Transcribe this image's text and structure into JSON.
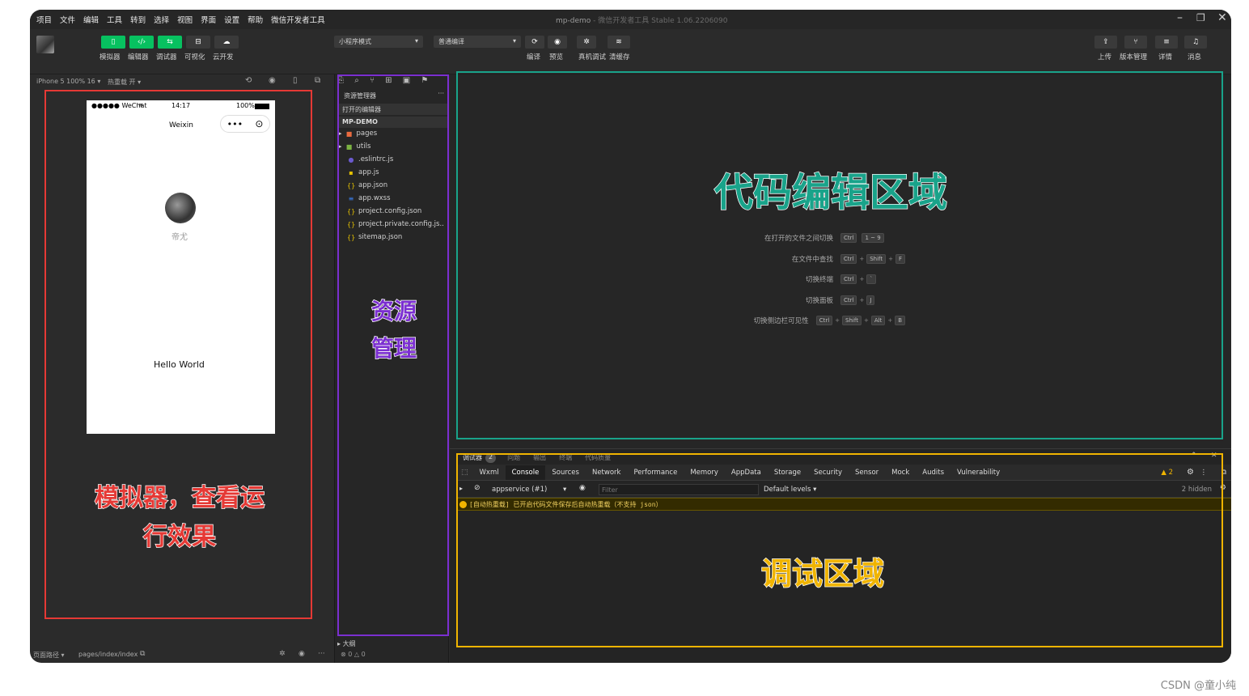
{
  "menu": [
    "项目",
    "文件",
    "编辑",
    "工具",
    "转到",
    "选择",
    "视图",
    "界面",
    "设置",
    "帮助",
    "微信开发者工具"
  ],
  "window": {
    "project": "mp-demo",
    "app_name": "微信开发者工具 Stable 1.06.2206090",
    "separator": "-"
  },
  "toolbar": {
    "mode_buttons": [
      {
        "icon": "phone-icon",
        "glyph": "▯",
        "label": "模拟器"
      },
      {
        "icon": "code-icon",
        "glyph": "‹/›",
        "label": "编辑器"
      },
      {
        "icon": "debug-icon",
        "glyph": "⇆",
        "label": "调试器"
      },
      {
        "icon": "layout-icon",
        "glyph": "⊟",
        "label": "可视化"
      },
      {
        "icon": "cloud-icon",
        "glyph": "☁",
        "label": "云开发"
      }
    ],
    "mode_select": "小程序模式",
    "compile_select": "普通编译",
    "actions": [
      {
        "icon": "refresh-icon",
        "glyph": "⟳",
        "label": "编译"
      },
      {
        "icon": "eye-icon",
        "glyph": "◉",
        "label": "预览"
      },
      {
        "icon": "bug-icon",
        "glyph": "✲",
        "label": "真机调试"
      },
      {
        "icon": "layers-icon",
        "glyph": "≋",
        "label": "清缓存"
      }
    ],
    "right_actions": [
      {
        "icon": "upload-icon",
        "glyph": "⇪",
        "label": "上传"
      },
      {
        "icon": "branch-icon",
        "glyph": "⑂",
        "label": "版本管理"
      },
      {
        "icon": "menu-icon",
        "glyph": "≡",
        "label": "详情"
      },
      {
        "icon": "bell-icon",
        "glyph": "♫",
        "label": "消息"
      }
    ]
  },
  "simulator": {
    "device": "iPhone 5 100% 16 ▾",
    "hot_reload": "热重载 开 ▾",
    "status_signal": "●●●●● WeChat",
    "status_time": "14:17",
    "status_battery": "100%",
    "nav_title": "Weixin",
    "user_name": "帝尤",
    "hello": "Hello World"
  },
  "explorer": {
    "title": "资源管理器",
    "more": "···",
    "open_editors": "打开的编辑器",
    "project": "MP-DEMO",
    "items": [
      {
        "name": "pages",
        "icon": "folder-icon",
        "color": "#e86a3f",
        "arrow": "▸"
      },
      {
        "name": "utils",
        "icon": "folder-icon",
        "color": "#7cb342",
        "arrow": "▸"
      },
      {
        "name": ".eslintrc.js",
        "icon": "eslint-icon",
        "color": "#6a5acd",
        "arrow": ""
      },
      {
        "name": "app.js",
        "icon": "js-icon",
        "color": "#e5c100",
        "arrow": ""
      },
      {
        "name": "app.json",
        "icon": "json-icon",
        "color": "#e5c100",
        "arrow": ""
      },
      {
        "name": "app.wxss",
        "icon": "wxss-icon",
        "color": "#3b82f6",
        "arrow": ""
      },
      {
        "name": "project.config.json",
        "icon": "json-icon",
        "color": "#e5c100",
        "arrow": ""
      },
      {
        "name": "project.private.config.js..",
        "icon": "json-icon",
        "color": "#e5c100",
        "arrow": ""
      },
      {
        "name": "sitemap.json",
        "icon": "json-icon",
        "color": "#e5c100",
        "arrow": ""
      }
    ],
    "outline": "大纲",
    "problems": "⊗ 0 △ 0"
  },
  "editor": {
    "shortcuts": [
      {
        "label": "在打开的文件之间切换",
        "keys": [
          "Ctrl",
          "1 ~ 9"
        ]
      },
      {
        "label": "在文件中查找",
        "keys": [
          "Ctrl",
          "+",
          "Shift",
          "+",
          "F"
        ]
      },
      {
        "label": "切换终端",
        "keys": [
          "Ctrl",
          "+",
          "`"
        ]
      },
      {
        "label": "切换面板",
        "keys": [
          "Ctrl",
          "+",
          "J"
        ]
      },
      {
        "label": "切换侧边栏可见性",
        "keys": [
          "Ctrl",
          "+",
          "Shift",
          "+",
          "Alt",
          "+",
          "B"
        ]
      }
    ]
  },
  "debugger": {
    "top_tabs": [
      "调试器",
      "问题",
      "输出",
      "终端",
      "代码质量"
    ],
    "badge": "2",
    "tabs": [
      "Wxml",
      "Console",
      "Sources",
      "Network",
      "Performance",
      "Memory",
      "AppData",
      "Storage",
      "Security",
      "Sensor",
      "Mock",
      "Audits",
      "Vulnerability"
    ],
    "warnings": "▲ 2",
    "context": "appservice (#1)",
    "filter_placeholder": "Filter",
    "levels": "Default levels ▾",
    "hidden": "2 hidden",
    "message": "[自动热重载] 已开启代码文件保存后自动热重载（不支持 json）"
  },
  "statusbar": {
    "path_label": "页面路径 ▾",
    "path": "pages/index/index"
  },
  "annotations": {
    "simulator_line1": "模拟器，查看运",
    "simulator_line2": "行效果",
    "explorer_line1": "资源",
    "explorer_line2": "管理",
    "editor": "代码编辑区域",
    "debug": "调试区域"
  },
  "credit": "CSDN @童小纯",
  "colors": {
    "simulator_box": "#e53935",
    "explorer_box": "#7b2fd0",
    "editor_box": "#19a38a",
    "debug_box": "#f0b400",
    "green": "#07c160"
  }
}
